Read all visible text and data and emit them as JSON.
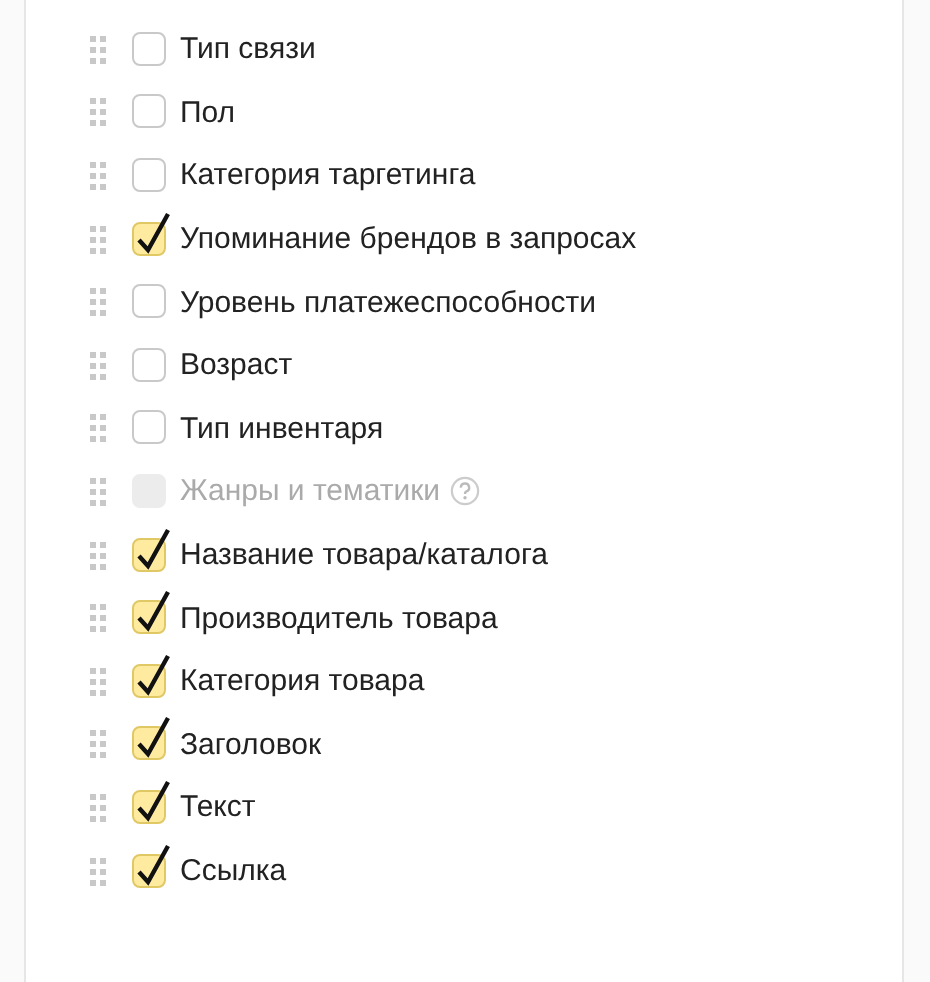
{
  "options": [
    {
      "label": "Тип связи",
      "checked": false,
      "disabled": false
    },
    {
      "label": "Пол",
      "checked": false,
      "disabled": false
    },
    {
      "label": "Категория таргетинга",
      "checked": false,
      "disabled": false
    },
    {
      "label": "Упоминание брендов в запросах",
      "checked": true,
      "disabled": false
    },
    {
      "label": "Уровень платежеспособности",
      "checked": false,
      "disabled": false
    },
    {
      "label": "Возраст",
      "checked": false,
      "disabled": false
    },
    {
      "label": "Тип инвентаря",
      "checked": false,
      "disabled": false
    },
    {
      "label": "Жанры и тематики",
      "checked": false,
      "disabled": true,
      "help": true
    },
    {
      "label": "Название товара/каталога",
      "checked": true,
      "disabled": false
    },
    {
      "label": "Производитель товара",
      "checked": true,
      "disabled": false
    },
    {
      "label": "Категория товара",
      "checked": true,
      "disabled": false
    },
    {
      "label": "Заголовок",
      "checked": true,
      "disabled": false
    },
    {
      "label": "Текст",
      "checked": true,
      "disabled": false
    },
    {
      "label": "Ссылка",
      "checked": true,
      "disabled": false
    }
  ]
}
